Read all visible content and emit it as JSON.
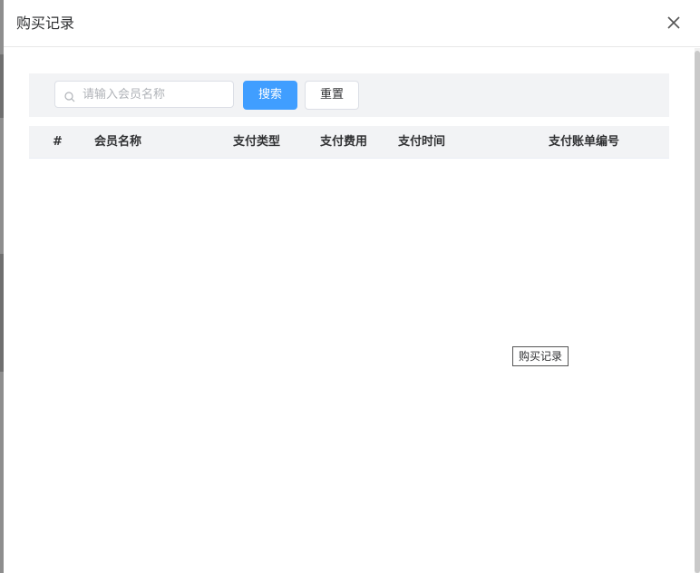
{
  "dialog": {
    "title": "购买记录"
  },
  "search": {
    "placeholder": "请输入会员名称",
    "value": "",
    "search_label": "搜索",
    "reset_label": "重置"
  },
  "table": {
    "columns": [
      "#",
      "会员名称",
      "支付类型",
      "支付费用",
      "支付时间",
      "支付账单编号"
    ],
    "rows": []
  },
  "tooltip": {
    "text": "购买记录"
  },
  "colors": {
    "primary": "#409eff",
    "toolbar_bg": "#f2f3f5",
    "text": "#303133"
  }
}
